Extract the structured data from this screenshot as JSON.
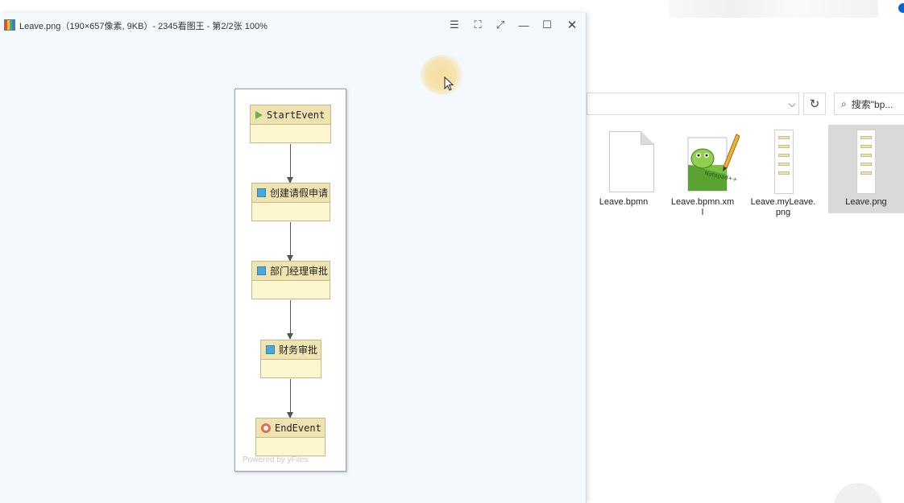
{
  "viewer": {
    "title": "Leave.png（190×657像素, 9KB）- 2345看图王 - 第2/2张 100%",
    "buttons": {
      "menu": "☰",
      "skin": "⛶",
      "fullscreen": "⤢",
      "minimize": "—",
      "maximize": "☐",
      "close": "✕"
    }
  },
  "diagram": {
    "nodes": [
      {
        "label": "StartEvent",
        "icon": "start-icon"
      },
      {
        "label": "创建请假申请",
        "icon": "task-icon"
      },
      {
        "label": "部门经理审批",
        "icon": "task-icon"
      },
      {
        "label": "财务审批",
        "icon": "task-icon"
      },
      {
        "label": "EndEvent",
        "icon": "end-icon"
      }
    ],
    "watermark": "Powered by yFiles"
  },
  "explorer": {
    "search_placeholder": "搜索\"bp...",
    "files": [
      {
        "name": "Leave.bpmn",
        "icon": "document-icon"
      },
      {
        "name": "Leave.bpmn.xm\nl",
        "icon": "notepad-plus-plus-icon"
      },
      {
        "name": "Leave.myLeave.\npng",
        "icon": "image-icon"
      },
      {
        "name": "Leave.png",
        "icon": "image-icon",
        "selected": true
      }
    ]
  },
  "colors": {
    "viewer_bg": "#f4f9fd",
    "node_head": "#efe4b0",
    "node_body": "#fdf6cf",
    "task_icon": "#4aa8d8",
    "start_icon": "#6fae4e",
    "end_icon": "#e0704f",
    "selection": "#d9d9d9"
  }
}
